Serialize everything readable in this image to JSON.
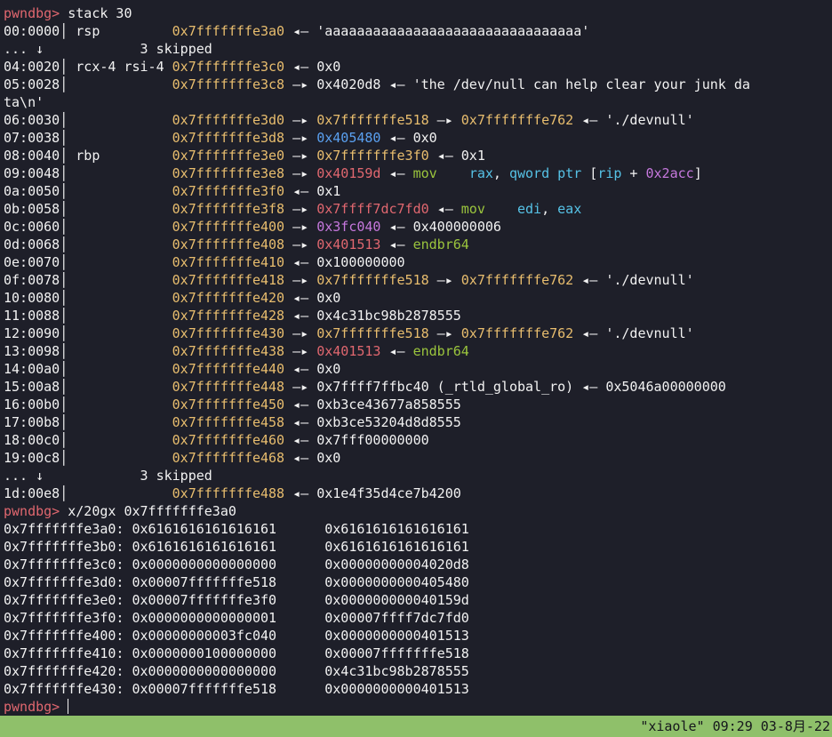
{
  "terminal": {
    "lines": [
      [
        {
          "t": "pwndbg> ",
          "c": "prompt"
        },
        {
          "t": "stack 30",
          "c": "plain"
        }
      ],
      [
        {
          "t": "00:0000│ rsp         ",
          "c": "plain"
        },
        {
          "t": "0x7fffffffe3a0",
          "c": "addr"
        },
        {
          "t": " ◂— 'aaaaaaaaaaaaaaaaaaaaaaaaaaaaaaaa'",
          "c": "plain"
        }
      ],
      [
        {
          "t": "... ↓            3 skipped",
          "c": "plain"
        }
      ],
      [
        {
          "t": "04:0020│ rcx-4 rsi-4 ",
          "c": "plain"
        },
        {
          "t": "0x7fffffffe3c0",
          "c": "addr"
        },
        {
          "t": " ◂— 0x0",
          "c": "plain"
        }
      ],
      [
        {
          "t": "05:0028│             ",
          "c": "plain"
        },
        {
          "t": "0x7fffffffe3c8",
          "c": "addr"
        },
        {
          "t": " —▸ 0x4020d8 ◂— 'the /dev/null can help clear your junk da",
          "c": "plain"
        }
      ],
      [
        {
          "t": "ta\\n'",
          "c": "plain"
        }
      ],
      [
        {
          "t": "06:0030│             ",
          "c": "plain"
        },
        {
          "t": "0x7fffffffe3d0",
          "c": "addr"
        },
        {
          "t": " —▸ ",
          "c": "plain"
        },
        {
          "t": "0x7fffffffe518",
          "c": "addr"
        },
        {
          "t": " —▸ ",
          "c": "plain"
        },
        {
          "t": "0x7fffffffe762",
          "c": "addr"
        },
        {
          "t": " ◂— './devnull'",
          "c": "plain"
        }
      ],
      [
        {
          "t": "07:0038│             ",
          "c": "plain"
        },
        {
          "t": "0x7fffffffe3d8",
          "c": "addr"
        },
        {
          "t": " —▸ ",
          "c": "plain"
        },
        {
          "t": "0x405480",
          "c": "heap"
        },
        {
          "t": " ◂— 0x0",
          "c": "plain"
        }
      ],
      [
        {
          "t": "08:0040│ rbp         ",
          "c": "plain"
        },
        {
          "t": "0x7fffffffe3e0",
          "c": "addr"
        },
        {
          "t": " —▸ ",
          "c": "plain"
        },
        {
          "t": "0x7fffffffe3f0",
          "c": "addr"
        },
        {
          "t": " ◂— 0x1",
          "c": "plain"
        }
      ],
      [
        {
          "t": "09:0048│             ",
          "c": "plain"
        },
        {
          "t": "0x7fffffffe3e8",
          "c": "addr"
        },
        {
          "t": " —▸ ",
          "c": "plain"
        },
        {
          "t": "0x40159d",
          "c": "code"
        },
        {
          "t": " ◂— ",
          "c": "plain"
        },
        {
          "t": "mov",
          "c": "mnem"
        },
        {
          "t": "    ",
          "c": "plain"
        },
        {
          "t": "rax",
          "c": "reg"
        },
        {
          "t": ", ",
          "c": "plain"
        },
        {
          "t": "qword ptr",
          "c": "reg"
        },
        {
          "t": " [",
          "c": "plain"
        },
        {
          "t": "rip",
          "c": "reg"
        },
        {
          "t": " + ",
          "c": "plain"
        },
        {
          "t": "0x2acc",
          "c": "num"
        },
        {
          "t": "]",
          "c": "plain"
        }
      ],
      [
        {
          "t": "0a:0050│             ",
          "c": "plain"
        },
        {
          "t": "0x7fffffffe3f0",
          "c": "addr"
        },
        {
          "t": " ◂— 0x1",
          "c": "plain"
        }
      ],
      [
        {
          "t": "0b:0058│             ",
          "c": "plain"
        },
        {
          "t": "0x7fffffffe3f8",
          "c": "addr"
        },
        {
          "t": " —▸ ",
          "c": "plain"
        },
        {
          "t": "0x7ffff7dc7fd0",
          "c": "code"
        },
        {
          "t": " ◂— ",
          "c": "plain"
        },
        {
          "t": "mov",
          "c": "mnem"
        },
        {
          "t": "    ",
          "c": "plain"
        },
        {
          "t": "edi",
          "c": "reg"
        },
        {
          "t": ", ",
          "c": "plain"
        },
        {
          "t": "eax",
          "c": "reg"
        }
      ],
      [
        {
          "t": "0c:0060│             ",
          "c": "plain"
        },
        {
          "t": "0x7fffffffe400",
          "c": "addr"
        },
        {
          "t": " —▸ ",
          "c": "plain"
        },
        {
          "t": "0x3fc040",
          "c": "data"
        },
        {
          "t": " ◂— 0x400000006",
          "c": "plain"
        }
      ],
      [
        {
          "t": "0d:0068│             ",
          "c": "plain"
        },
        {
          "t": "0x7fffffffe408",
          "c": "addr"
        },
        {
          "t": " —▸ ",
          "c": "plain"
        },
        {
          "t": "0x401513",
          "c": "code"
        },
        {
          "t": " ◂— ",
          "c": "plain"
        },
        {
          "t": "endbr64",
          "c": "mnem"
        }
      ],
      [
        {
          "t": "0e:0070│             ",
          "c": "plain"
        },
        {
          "t": "0x7fffffffe410",
          "c": "addr"
        },
        {
          "t": " ◂— 0x100000000",
          "c": "plain"
        }
      ],
      [
        {
          "t": "0f:0078│             ",
          "c": "plain"
        },
        {
          "t": "0x7fffffffe418",
          "c": "addr"
        },
        {
          "t": " —▸ ",
          "c": "plain"
        },
        {
          "t": "0x7fffffffe518",
          "c": "addr"
        },
        {
          "t": " —▸ ",
          "c": "plain"
        },
        {
          "t": "0x7fffffffe762",
          "c": "addr"
        },
        {
          "t": " ◂— './devnull'",
          "c": "plain"
        }
      ],
      [
        {
          "t": "10:0080│             ",
          "c": "plain"
        },
        {
          "t": "0x7fffffffe420",
          "c": "addr"
        },
        {
          "t": " ◂— 0x0",
          "c": "plain"
        }
      ],
      [
        {
          "t": "11:0088│             ",
          "c": "plain"
        },
        {
          "t": "0x7fffffffe428",
          "c": "addr"
        },
        {
          "t": " ◂— 0x4c31bc98b2878555",
          "c": "plain"
        }
      ],
      [
        {
          "t": "12:0090│             ",
          "c": "plain"
        },
        {
          "t": "0x7fffffffe430",
          "c": "addr"
        },
        {
          "t": " —▸ ",
          "c": "plain"
        },
        {
          "t": "0x7fffffffe518",
          "c": "addr"
        },
        {
          "t": " —▸ ",
          "c": "plain"
        },
        {
          "t": "0x7fffffffe762",
          "c": "addr"
        },
        {
          "t": " ◂— './devnull'",
          "c": "plain"
        }
      ],
      [
        {
          "t": "13:0098│             ",
          "c": "plain"
        },
        {
          "t": "0x7fffffffe438",
          "c": "addr"
        },
        {
          "t": " —▸ ",
          "c": "plain"
        },
        {
          "t": "0x401513",
          "c": "code"
        },
        {
          "t": " ◂— ",
          "c": "plain"
        },
        {
          "t": "endbr64",
          "c": "mnem"
        }
      ],
      [
        {
          "t": "14:00a0│             ",
          "c": "plain"
        },
        {
          "t": "0x7fffffffe440",
          "c": "addr"
        },
        {
          "t": " ◂— 0x0",
          "c": "plain"
        }
      ],
      [
        {
          "t": "15:00a8│             ",
          "c": "plain"
        },
        {
          "t": "0x7fffffffe448",
          "c": "addr"
        },
        {
          "t": " —▸ 0x7ffff7ffbc40 (_rtld_global_ro) ◂— 0x5046a00000000",
          "c": "plain"
        }
      ],
      [
        {
          "t": "16:00b0│             ",
          "c": "plain"
        },
        {
          "t": "0x7fffffffe450",
          "c": "addr"
        },
        {
          "t": " ◂— 0xb3ce43677a858555",
          "c": "plain"
        }
      ],
      [
        {
          "t": "17:00b8│             ",
          "c": "plain"
        },
        {
          "t": "0x7fffffffe458",
          "c": "addr"
        },
        {
          "t": " ◂— 0xb3ce53204d8d8555",
          "c": "plain"
        }
      ],
      [
        {
          "t": "18:00c0│             ",
          "c": "plain"
        },
        {
          "t": "0x7fffffffe460",
          "c": "addr"
        },
        {
          "t": " ◂— 0x7fff00000000",
          "c": "plain"
        }
      ],
      [
        {
          "t": "19:00c8│             ",
          "c": "plain"
        },
        {
          "t": "0x7fffffffe468",
          "c": "addr"
        },
        {
          "t": " ◂— 0x0",
          "c": "plain"
        }
      ],
      [
        {
          "t": "... ↓            3 skipped",
          "c": "plain"
        }
      ],
      [
        {
          "t": "1d:00e8│             ",
          "c": "plain"
        },
        {
          "t": "0x7fffffffe488",
          "c": "addr"
        },
        {
          "t": " ◂— 0x1e4f35d4ce7b4200",
          "c": "plain"
        }
      ],
      [
        {
          "t": "pwndbg> ",
          "c": "prompt"
        },
        {
          "t": "x/20gx 0x7fffffffe3a0",
          "c": "plain"
        }
      ],
      [
        {
          "t": "0x7fffffffe3a0: 0x6161616161616161      0x6161616161616161",
          "c": "plain"
        }
      ],
      [
        {
          "t": "0x7fffffffe3b0: 0x6161616161616161      0x6161616161616161",
          "c": "plain"
        }
      ],
      [
        {
          "t": "0x7fffffffe3c0: 0x0000000000000000      0x00000000004020d8",
          "c": "plain"
        }
      ],
      [
        {
          "t": "0x7fffffffe3d0: 0x00007fffffffe518      0x0000000000405480",
          "c": "plain"
        }
      ],
      [
        {
          "t": "0x7fffffffe3e0: 0x00007fffffffe3f0      0x000000000040159d",
          "c": "plain"
        }
      ],
      [
        {
          "t": "0x7fffffffe3f0: 0x0000000000000001      0x00007ffff7dc7fd0",
          "c": "plain"
        }
      ],
      [
        {
          "t": "0x7fffffffe400: 0x00000000003fc040      0x0000000000401513",
          "c": "plain"
        }
      ],
      [
        {
          "t": "0x7fffffffe410: 0x0000000100000000      0x00007fffffffe518",
          "c": "plain"
        }
      ],
      [
        {
          "t": "0x7fffffffe420: 0x0000000000000000      0x4c31bc98b2878555",
          "c": "plain"
        }
      ],
      [
        {
          "t": "0x7fffffffe430: 0x00007fffffffe518      0x0000000000401513",
          "c": "plain"
        }
      ]
    ],
    "prompt": "pwndbg> ",
    "input_value": ""
  },
  "status_bar": {
    "text": "\"xiaole\" 09:29 03-8月-22"
  },
  "colors": {
    "background": "#1e1f29",
    "prompt": "#e0676f",
    "stack_address": "#e8bd6e",
    "code_address": "#e0676f",
    "data_address": "#c678dd",
    "heap_address": "#5aa0f0",
    "mnemonic": "#9bc53d",
    "register": "#56c2e6",
    "status_bar_bg": "#8fc06a"
  }
}
